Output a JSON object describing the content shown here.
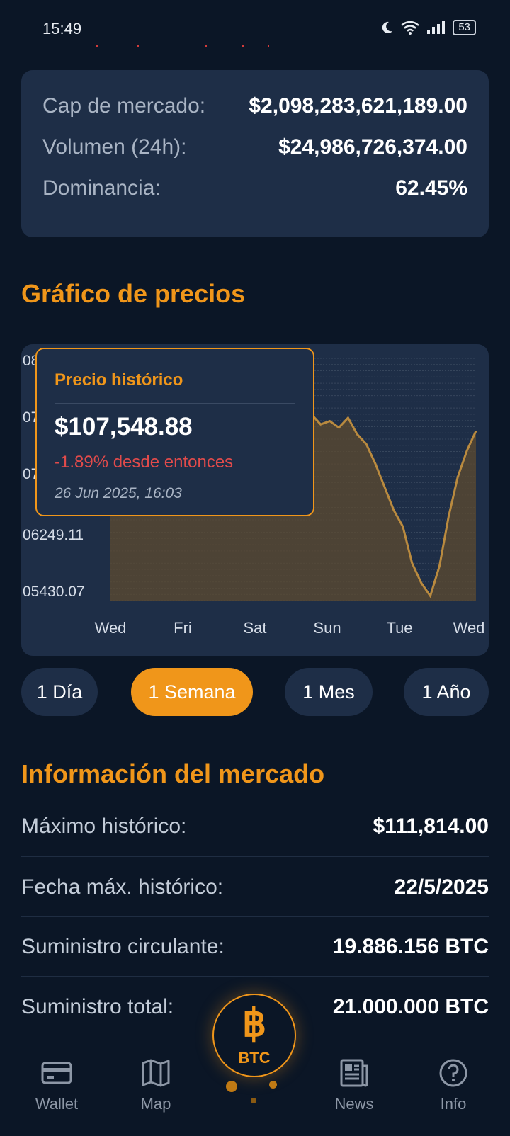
{
  "status_bar": {
    "time": "15:49",
    "battery": "53"
  },
  "market_stats": [
    {
      "label": "Cap de mercado:",
      "value": "$2,098,283,621,189.00"
    },
    {
      "label": "Volumen (24h):",
      "value": "$24,986,726,374.00"
    },
    {
      "label": "Dominancia:",
      "value": "62.45%"
    }
  ],
  "chart_section": {
    "title": "Gráfico de precios",
    "y_tick_labels": [
      "08",
      "07",
      "07",
      "06249.11",
      "05430.07"
    ],
    "tooltip": {
      "title": "Precio histórico",
      "price": "$107,548.88",
      "change": "-1.89% desde entonces",
      "date": "26 Jun 2025, 16:03"
    }
  },
  "chart_data": {
    "type": "area",
    "x_tick_labels": [
      "Wed",
      "Fri",
      "Sat",
      "Sun",
      "Tue",
      "Wed"
    ],
    "y_axis_visible_labels": [
      "06249.11",
      "05430.07"
    ],
    "series": [
      {
        "values": [
          108050,
          108000,
          107950,
          108050,
          107900,
          107850,
          107800,
          107700,
          107750,
          107900,
          108300,
          108600,
          108900,
          108700,
          108400,
          108200,
          108100,
          108400,
          108750,
          109050,
          108850,
          108500,
          108250,
          108100,
          108150,
          108050,
          108200,
          107950,
          107800,
          107500,
          107150,
          106800,
          106550,
          106000,
          105700,
          105500,
          105950,
          106700,
          107300,
          107700,
          108000
        ]
      }
    ],
    "ylim": [
      105430.07,
      109100
    ],
    "colors": {
      "line": "#b98a3f",
      "fill": "#5d4b2f",
      "grid": "#4b5a6e"
    }
  },
  "time_ranges": [
    {
      "label": "1 Día",
      "active": false
    },
    {
      "label": "1 Semana",
      "active": true
    },
    {
      "label": "1 Mes",
      "active": false
    },
    {
      "label": "1 Año",
      "active": false
    }
  ],
  "market_info": {
    "title": "Información del mercado",
    "rows": [
      {
        "label": "Máximo histórico:",
        "value": "$111,814.00"
      },
      {
        "label": "Fecha máx. histórico:",
        "value": "22/5/2025"
      },
      {
        "label": "Suministro circulante:",
        "value": "19.886.156 BTC"
      },
      {
        "label": "Suministro total:",
        "value": "21.000.000 BTC"
      }
    ]
  },
  "bottom_nav": {
    "items": [
      {
        "label": "Wallet",
        "icon": "wallet-icon"
      },
      {
        "label": "Map",
        "icon": "map-icon"
      },
      {
        "label": "News",
        "icon": "news-icon"
      },
      {
        "label": "Info",
        "icon": "info-icon"
      }
    ],
    "center": {
      "symbol": "฿",
      "label": "BTC"
    }
  },
  "colors": {
    "accent": "#f0961a",
    "background": "#0b1626",
    "card": "#1e2e47",
    "negative": "#e24b4b"
  }
}
